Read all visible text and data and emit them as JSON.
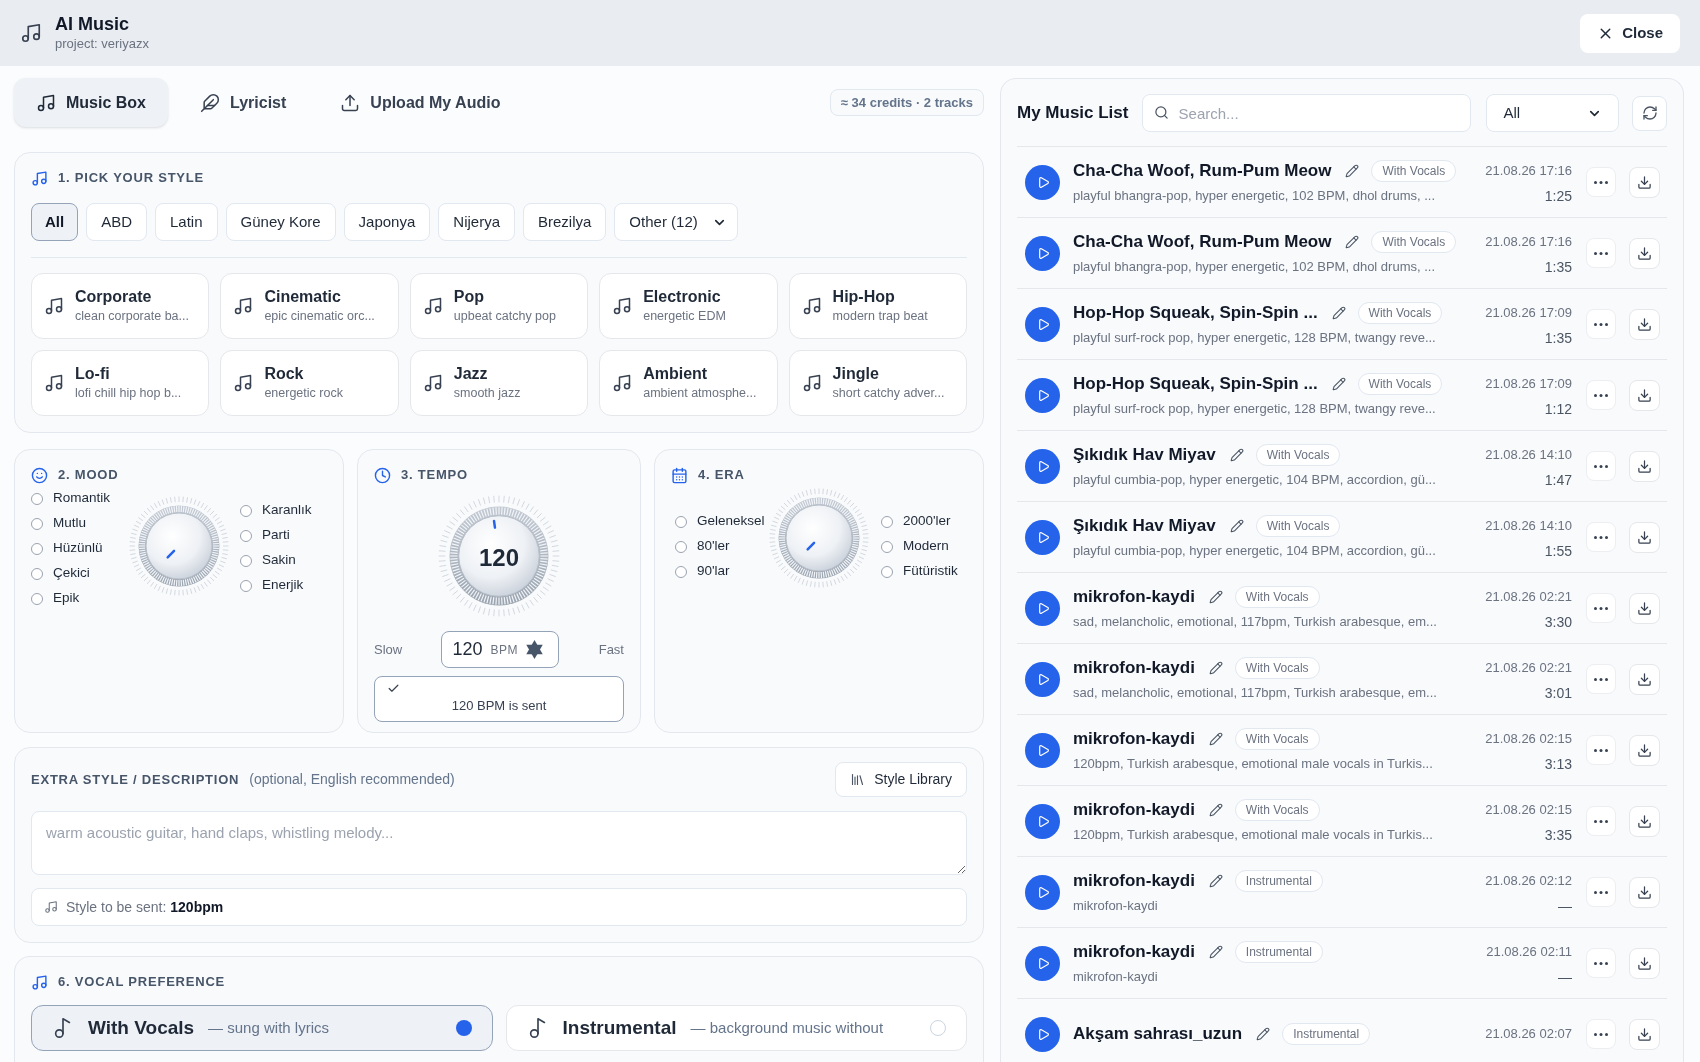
{
  "header": {
    "title": "AI Music",
    "subtitle": "project: veriyazx",
    "close": "Close"
  },
  "tabs": [
    {
      "label": "Music Box",
      "selected": true
    },
    {
      "label": "Lyricist",
      "selected": false
    },
    {
      "label": "Upload My Audio",
      "selected": false
    }
  ],
  "credits": "≈ 34 credits · 2 tracks",
  "style_section": {
    "title": "1. PICK YOUR STYLE",
    "regions": [
      {
        "label": "All",
        "selected": true
      },
      {
        "label": "ABD",
        "selected": false
      },
      {
        "label": "Latin",
        "selected": false
      },
      {
        "label": "Güney Kore",
        "selected": false
      },
      {
        "label": "Japonya",
        "selected": false
      },
      {
        "label": "Nijerya",
        "selected": false
      },
      {
        "label": "Brezilya",
        "selected": false
      }
    ],
    "more_regions": "Other (12)",
    "styles": [
      {
        "name": "Corporate",
        "description": "clean corporate ba..."
      },
      {
        "name": "Cinematic",
        "description": "epic cinematic orc..."
      },
      {
        "name": "Pop",
        "description": "upbeat catchy pop"
      },
      {
        "name": "Electronic",
        "description": "energetic EDM"
      },
      {
        "name": "Hip-Hop",
        "description": "modern trap beat"
      },
      {
        "name": "Lo-fi",
        "description": "lofi chill hip hop b..."
      },
      {
        "name": "Rock",
        "description": "energetic rock"
      },
      {
        "name": "Jazz",
        "description": "smooth jazz"
      },
      {
        "name": "Ambient",
        "description": "ambient atmosphe..."
      },
      {
        "name": "Jingle",
        "description": "short catchy adver..."
      }
    ]
  },
  "mood": {
    "title": "2. MOOD",
    "left_options": [
      {
        "label": "Romantik",
        "selected": false
      },
      {
        "label": "Mutlu",
        "selected": false
      },
      {
        "label": "Hüzünlü",
        "selected": false
      },
      {
        "label": "Çekici",
        "selected": false
      },
      {
        "label": "Epik",
        "selected": false
      }
    ],
    "right_options": [
      {
        "label": "Karanlık",
        "selected": false
      },
      {
        "label": "Parti",
        "selected": false
      },
      {
        "label": "Sakin",
        "selected": false
      },
      {
        "label": "Enerjik",
        "selected": false
      }
    ]
  },
  "tempo": {
    "title": "3. TEMPO",
    "knob": {
      "level": 0.47,
      "value": "120"
    },
    "slow": "Slow",
    "fast": "Fast",
    "bpm": {
      "value": "120",
      "unit": "BPM"
    },
    "status": "120 BPM is sent"
  },
  "era": {
    "title": "4. ERA",
    "left_options": [
      {
        "label": "Geleneksel",
        "selected": false
      },
      {
        "label": "80'ler",
        "selected": false
      },
      {
        "label": "90'lar",
        "selected": false
      }
    ],
    "right_options": [
      {
        "label": "2000'ler",
        "selected": false
      },
      {
        "label": "Modern",
        "selected": false
      },
      {
        "label": "Fütüristik",
        "selected": false
      }
    ]
  },
  "extra_style": {
    "title": "EXTRA STYLE / DESCRIPTION",
    "hint": "(optional, English recommended)",
    "library_button": "Style Library",
    "placeholder": "warm acoustic guitar, hand claps, whistling melody...",
    "summary": "Style to be sent: **120bpm**"
  },
  "vocal": {
    "title": "6. VOCAL PREFERENCE",
    "options": [
      {
        "label": "With Vocals",
        "description": "— sung with lyrics",
        "selected": true
      },
      {
        "label": "Instrumental",
        "description": "— background music without",
        "selected": false
      }
    ]
  },
  "music_list": {
    "title": "My Music List",
    "search": {
      "placeholder": "Search..."
    },
    "filter": "All",
    "tracks": [
      {
        "title": "Cha-Cha Woof, Rum-Pum Meow",
        "tag": "With Vocals",
        "date": "21.08.26 17:16",
        "duration": "1:25",
        "description": "playful bhangra-pop, hyper energetic, 102 BPM, dhol drums, ..."
      },
      {
        "title": "Cha-Cha Woof, Rum-Pum Meow",
        "tag": "With Vocals",
        "date": "21.08.26 17:16",
        "duration": "1:35",
        "description": "playful bhangra-pop, hyper energetic, 102 BPM, dhol drums, ..."
      },
      {
        "title": "Hop-Hop Squeak, Spin-Spin ...",
        "tag": "With Vocals",
        "date": "21.08.26 17:09",
        "duration": "1:35",
        "description": "playful surf-rock pop, hyper energetic, 128 BPM, twangy reve..."
      },
      {
        "title": "Hop-Hop Squeak, Spin-Spin ...",
        "tag": "With Vocals",
        "date": "21.08.26 17:09",
        "duration": "1:12",
        "description": "playful surf-rock pop, hyper energetic, 128 BPM, twangy reve..."
      },
      {
        "title": "Şıkıdık Hav Miyav",
        "tag": "With Vocals",
        "date": "21.08.26 14:10",
        "duration": "1:47",
        "description": "playful cumbia-pop, hyper energetic, 104 BPM, accordion, gü..."
      },
      {
        "title": "Şıkıdık Hav Miyav",
        "tag": "With Vocals",
        "date": "21.08.26 14:10",
        "duration": "1:55",
        "description": "playful cumbia-pop, hyper energetic, 104 BPM, accordion, gü..."
      },
      {
        "title": "mikrofon-kaydi",
        "tag": "With Vocals",
        "date": "21.08.26 02:21",
        "duration": "3:30",
        "description": "sad, melancholic, emotional, 117bpm, Turkish arabesque, em..."
      },
      {
        "title": "mikrofon-kaydi",
        "tag": "With Vocals",
        "date": "21.08.26 02:21",
        "duration": "3:01",
        "description": "sad, melancholic, emotional, 117bpm, Turkish arabesque, em..."
      },
      {
        "title": "mikrofon-kaydi",
        "tag": "With Vocals",
        "date": "21.08.26 02:15",
        "duration": "3:13",
        "description": "120bpm, Turkish arabesque, emotional male vocals in Turkis..."
      },
      {
        "title": "mikrofon-kaydi",
        "tag": "With Vocals",
        "date": "21.08.26 02:15",
        "duration": "3:35",
        "description": "120bpm, Turkish arabesque, emotional male vocals in Turkis..."
      },
      {
        "title": "mikrofon-kaydi",
        "tag": "Instrumental",
        "date": "21.08.26 02:12",
        "duration": "—",
        "description": "mikrofon-kaydi"
      },
      {
        "title": "mikrofon-kaydi",
        "tag": "Instrumental",
        "date": "21.08.26 02:11",
        "duration": "—",
        "description": "mikrofon-kaydi"
      },
      {
        "title": "Akşam sahrası_uzun",
        "tag": "Instrumental",
        "date": "21.08.26 02:07"
      }
    ]
  }
}
